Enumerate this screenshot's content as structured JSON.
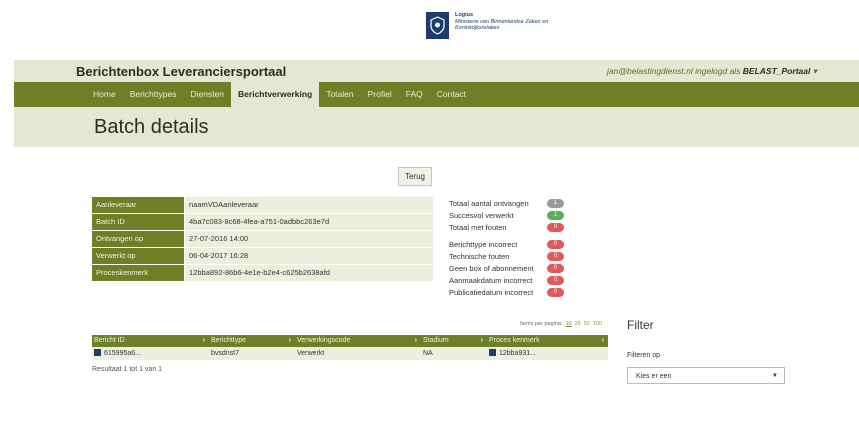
{
  "logo": {
    "line1": "Logius",
    "line2": "Ministerie van Binnenlandse Zaken en",
    "line3": "Koninkrijksrelaties"
  },
  "header": {
    "brand": "Berichtenbox Leveranciersportaal",
    "user_email": "jan@belastingdienst.nl",
    "user_middle": " ingelogd als ",
    "user_role": "BELAST_Portaal",
    "user_caret": "▾"
  },
  "nav": {
    "items": [
      "Home",
      "Berichttypes",
      "Diensten",
      "Berichtverwerking",
      "Totalen",
      "Profiel",
      "FAQ",
      "Contact"
    ],
    "active_index": 3
  },
  "page": {
    "title": "Batch details",
    "back_label": "Terug"
  },
  "details": [
    {
      "label": "Aanleveraar",
      "value": "naamVDAanleveraar"
    },
    {
      "label": "Batch ID",
      "value": "4ba7c083-8c68-4fea-a751-0adbbc263e7d"
    },
    {
      "label": "Ontvangen op",
      "value": "27-07-2016 14:00"
    },
    {
      "label": "Verwerkt op",
      "value": "06-04-2017 16:28"
    },
    {
      "label": "Proceskenmerk",
      "value": "12bba892-86b6-4e1e-b2e4-c625b2638afd"
    }
  ],
  "stats": [
    {
      "label": "Totaal aantal ontvangen",
      "value": "1",
      "color": "#9a9a9a"
    },
    {
      "label": "Succesvol verwerkt",
      "value": "1",
      "color": "#5cae5c"
    },
    {
      "label": "Totaal met fouten",
      "value": "0",
      "color": "#e05a5a"
    },
    {
      "label": "Berichttype incorrect",
      "value": "0",
      "color": "#e05a5a"
    },
    {
      "label": "Technische fouten",
      "value": "0",
      "color": "#e05a5a"
    },
    {
      "label": "Geen box of abonnement",
      "value": "0",
      "color": "#e05a5a"
    },
    {
      "label": "Aanmaakdatum incorrect",
      "value": "0",
      "color": "#e05a5a"
    },
    {
      "label": "Publicatiedatum incorrect",
      "value": "0",
      "color": "#e05a5a"
    }
  ],
  "paging": {
    "label": "Items per pagina:",
    "sizes": [
      "10",
      "25",
      "50",
      "100"
    ]
  },
  "table": {
    "headers": [
      "Bericht ID",
      "Berichttype",
      "Verwerkingscode",
      "Stadium",
      "Proces kenmerk"
    ],
    "rows": [
      [
        "615995a6...",
        "bvsdnst7",
        "Verwerkt",
        "NA",
        "12bba931..."
      ]
    ],
    "result_text": "Resultaat 1 tot 1 van 1"
  },
  "filter": {
    "title": "Filter",
    "label": "Filteren op",
    "placeholder": "Kies er een"
  },
  "colors": {
    "nav_green": "#6f7f28",
    "light_band": "#e6e6d4",
    "badge_red": "#e05a5a",
    "badge_green": "#5cae5c",
    "badge_gray": "#9a9a9a"
  }
}
